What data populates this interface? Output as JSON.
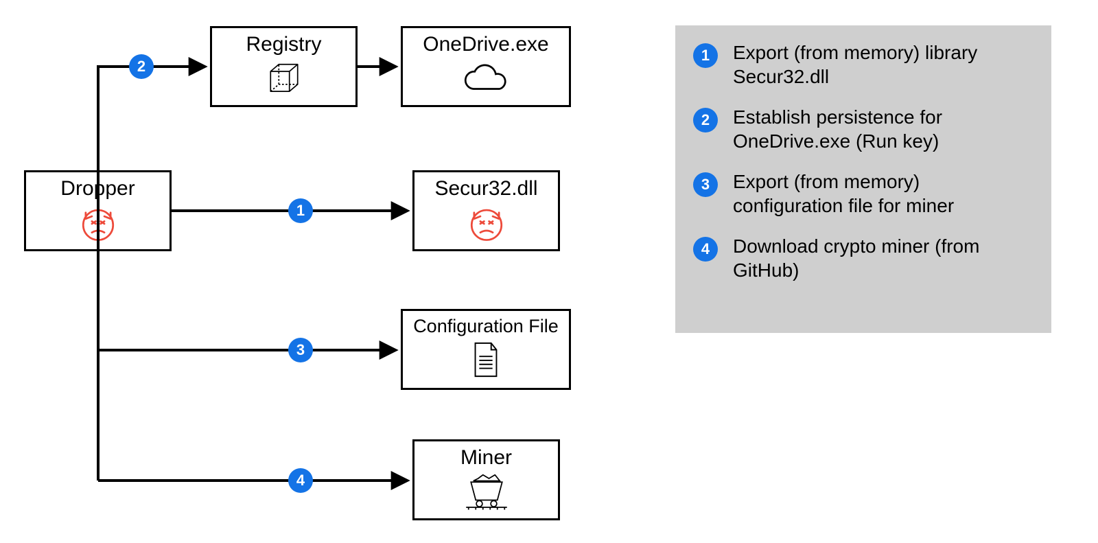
{
  "diagram": {
    "nodes": {
      "dropper": {
        "label": "Dropper"
      },
      "registry": {
        "label": "Registry"
      },
      "onedrive": {
        "label": "OneDrive.exe"
      },
      "secur32": {
        "label": "Secur32.dll"
      },
      "config": {
        "label": "Configuration File"
      },
      "miner": {
        "label": "Miner"
      }
    },
    "badges": {
      "b1": "1",
      "b2": "2",
      "b3": "3",
      "b4": "4"
    }
  },
  "legend": {
    "items": [
      {
        "num": "1",
        "text": "Export (from memory) library Secur32.dll"
      },
      {
        "num": "2",
        "text": "Establish persistence for OneDrive.exe (Run key)"
      },
      {
        "num": "3",
        "text": "Export (from memory) configuration file for miner"
      },
      {
        "num": "4",
        "text": "Download crypto miner (from GitHub)"
      }
    ]
  },
  "colors": {
    "badge": "#1473E6",
    "malicious": "#ED4A3A",
    "legend_bg": "#cfcfcf"
  }
}
